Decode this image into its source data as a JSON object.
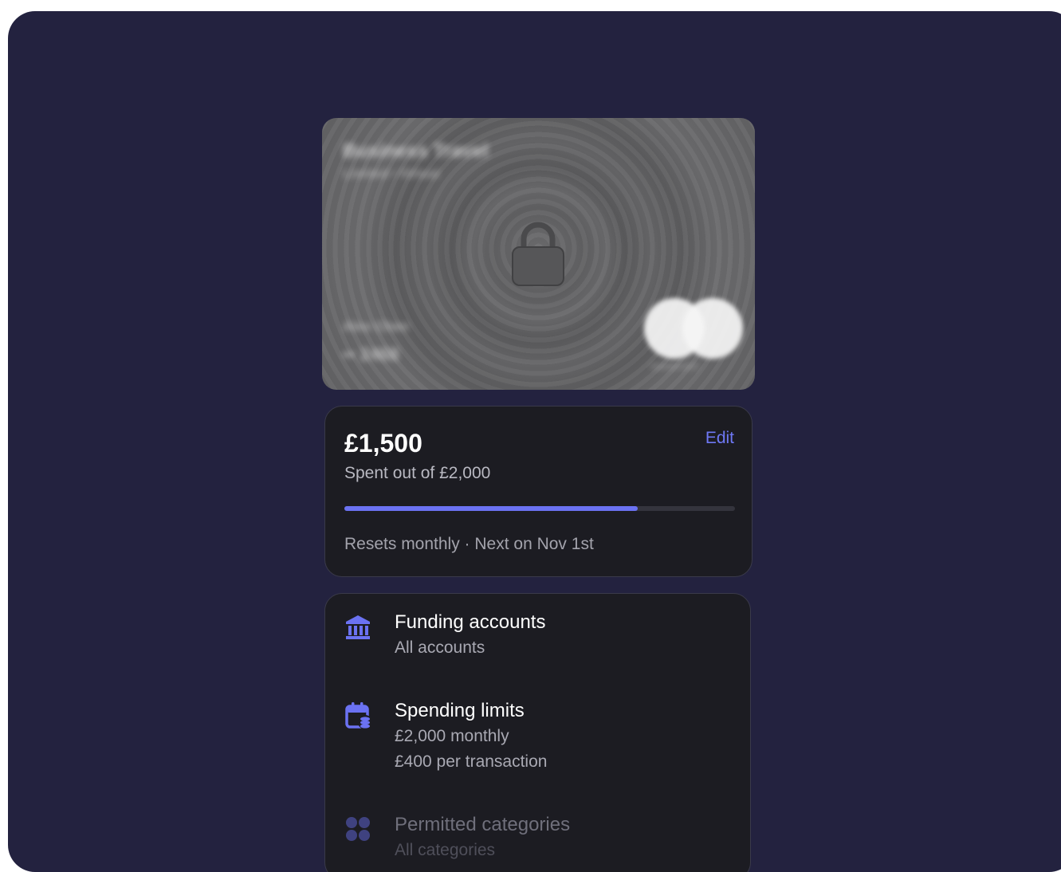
{
  "card": {
    "name": "Business Travel",
    "subtitle": "Limited • Virtual",
    "holder": "Alex Chen",
    "number": "•• 2468",
    "brand": "mastercard"
  },
  "spend": {
    "amount": "£1,500",
    "subtitle": "Spent out of £2,000",
    "edit_label": "Edit",
    "progress_fraction": 0.75,
    "resets_text": "Resets monthly · Next on Nov 1st"
  },
  "settings": {
    "funding": {
      "title": "Funding accounts",
      "detail": "All accounts",
      "icon": "bank-icon"
    },
    "limits": {
      "title": "Spending limits",
      "detail_1": "£2,000 monthly",
      "detail_2": "£400 per transaction",
      "icon": "calendar-coins-icon"
    },
    "categories": {
      "title": "Permitted categories",
      "detail": "All categories",
      "icon": "categories-grid-icon"
    }
  },
  "colors": {
    "background": "#23223f",
    "panel": "#1c1c22",
    "accent": "#6b72f2",
    "card": "#666668"
  }
}
